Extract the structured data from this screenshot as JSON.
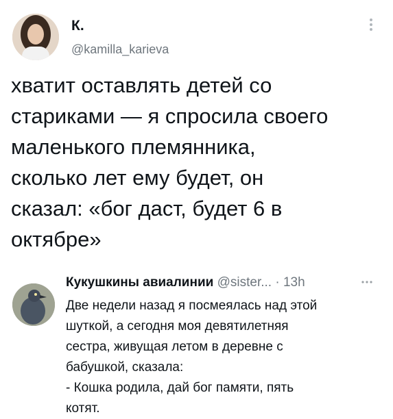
{
  "tweet1": {
    "name": "К.",
    "handle": "@kamilla_karieva",
    "more_icon": "vertical-dots-icon",
    "text": "хватит оставлять детей со\nстариками — я спросила своего\nмаленького племянника,\nсколько лет ему будет, он\nсказал: «бог даст, будет 6 в\nоктябре»"
  },
  "tweet2": {
    "name": "Кукушкины авиалинии",
    "handle": "@sister...",
    "separator": " · ",
    "time": "13h",
    "more_icon": "horizontal-dots-icon",
    "text": "Две недели назад я посмеялась над этой\nшуткой, а сегодня моя девятилетняя\nсестра, живущая летом в деревне с\nбабушкой, сказала:\n- Кошка родила, дай бог памяти, пять\nкотят."
  },
  "colors": {
    "text": "#0f1419",
    "secondary": "#6e767d",
    "background": "#ffffff",
    "divider": "#f0f0f0"
  }
}
